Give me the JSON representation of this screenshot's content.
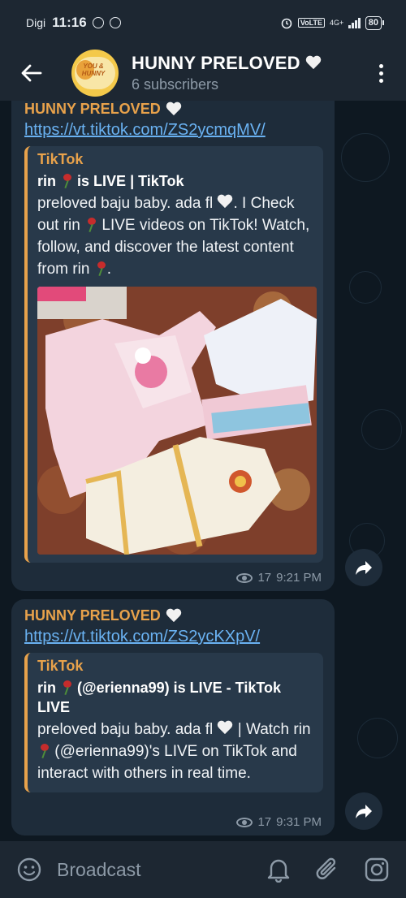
{
  "status_bar": {
    "carrier": "Digi",
    "time": "11:16",
    "volte": "VoLTE",
    "network": "4G+",
    "battery": "80"
  },
  "header": {
    "title": "HUNNY PRELOVED",
    "subscribers": "6 subscribers",
    "avatar_text": "YOU & HUNNY"
  },
  "messages": [
    {
      "author": "HUNNY PRELOVED",
      "link": "https://vt.tiktok.com/ZS2ycmqMV/",
      "preview": {
        "site": "TikTok",
        "title_name": "rin",
        "title_rest": "is LIVE | TikTok",
        "desc_1": "preloved baju baby. ada fl",
        "desc_2": ". I Check out rin",
        "desc_3": "LIVE videos on TikTok! Watch, follow, and discover the latest content from rin",
        "desc_4": "."
      },
      "views": "17",
      "time": "9:21 PM"
    },
    {
      "author": "HUNNY PRELOVED",
      "link": "https://vt.tiktok.com/ZS2ycKXpV/",
      "preview": {
        "site": "TikTok",
        "title_name": "rin",
        "title_rest": "(@erienna99) is LIVE - TikTok LIVE",
        "desc_1": "preloved baju baby. ada fl",
        "desc_2": "| Watch rin",
        "desc_3": "(@erienna99)'s LIVE on TikTok and interact with others in real time."
      },
      "views": "17",
      "time": "9:31 PM"
    }
  ],
  "composer": {
    "placeholder": "Broadcast"
  },
  "colors": {
    "accent": "#e8a24b",
    "link": "#6ab2f2",
    "bubble": "#1e2c3a",
    "bar": "#1d2732"
  }
}
